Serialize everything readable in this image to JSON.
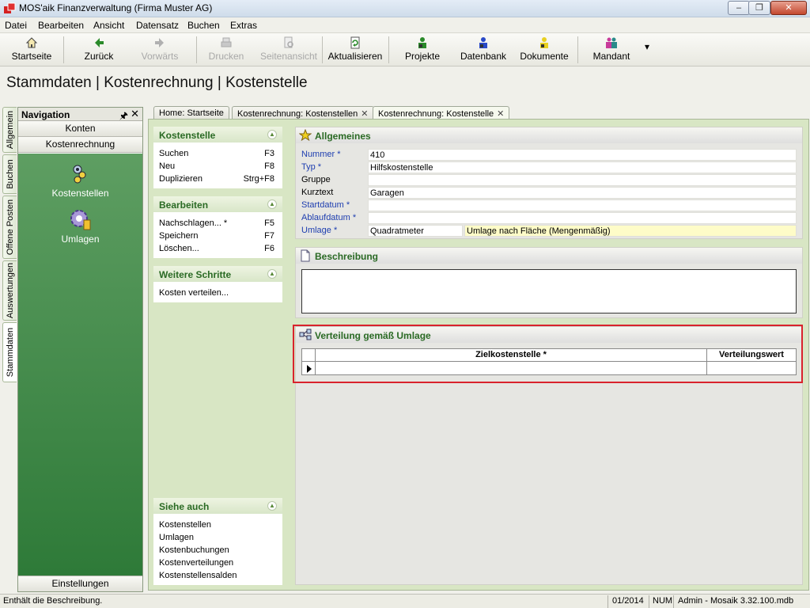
{
  "window": {
    "title": "MOS'aik Finanzverwaltung (Firma Muster AG)",
    "buttons": {
      "minimize": "–",
      "restore": "❐",
      "close": "✕"
    }
  },
  "menu": {
    "items": [
      {
        "label": "Datei"
      },
      {
        "label": "Bearbeiten"
      },
      {
        "label": "Ansicht"
      },
      {
        "label": "Datensatz"
      },
      {
        "label": "Buchen"
      },
      {
        "label": "Extras"
      }
    ]
  },
  "toolbar": {
    "startseite": "Startseite",
    "zurueck": "Zurück",
    "vorwaerts": "Vorwärts",
    "drucken": "Drucken",
    "seitenansicht": "Seitenansicht",
    "aktualisieren": "Aktualisieren",
    "projekte": "Projekte",
    "datenbank": "Datenbank",
    "dokumente": "Dokumente",
    "mandant": "Mandant",
    "more": "▾"
  },
  "page_title": "Stammdaten | Kostenrechnung | Kostenstelle",
  "vertical_tabs": [
    "Allgemein",
    "Buchen",
    "Offene Posten",
    "Auswertungen",
    "Stammdaten"
  ],
  "navigation": {
    "title": "Navigation",
    "pin": "🖈",
    "close": "✕",
    "groups": [
      "Konten",
      "Kostenrechnung"
    ],
    "entries": [
      "Kostenstellen",
      "Umlagen"
    ],
    "footer": "Einstellungen"
  },
  "doc_tabs": [
    {
      "label": "Home: Startseite",
      "closable": false
    },
    {
      "label": "Kostenrechnung: Kostenstellen",
      "closable": true
    },
    {
      "label": "Kostenrechnung: Kostenstelle",
      "closable": true
    }
  ],
  "tab_close": "✕",
  "tasks": {
    "kostenstelle": {
      "title": "Kostenstelle",
      "items": [
        {
          "label": "Suchen",
          "key": "F3"
        },
        {
          "label": "Neu",
          "key": "F8"
        },
        {
          "label": "Duplizieren",
          "key": "Strg+F8"
        }
      ]
    },
    "bearbeiten": {
      "title": "Bearbeiten",
      "items": [
        {
          "label": "Nachschlagen... *",
          "key": "F5"
        },
        {
          "label": "Speichern",
          "key": "F7"
        },
        {
          "label": "Löschen...",
          "key": "F6"
        }
      ]
    },
    "weitere": {
      "title": "Weitere Schritte",
      "items": [
        {
          "label": "Kosten verteilen...",
          "key": ""
        }
      ]
    },
    "siehe": {
      "title": "Siehe auch",
      "items": [
        {
          "label": "Kostenstellen"
        },
        {
          "label": "Umlagen"
        },
        {
          "label": "Kostenbuchungen"
        },
        {
          "label": "Kostenverteilungen"
        },
        {
          "label": "Kostenstellensalden"
        }
      ]
    },
    "collapse_glyph": "▲"
  },
  "allgemeines": {
    "title": "Allgemeines",
    "fields": {
      "nummer": {
        "label": "Nummer *",
        "value": "410"
      },
      "typ": {
        "label": "Typ *",
        "value": "Hilfskostenstelle"
      },
      "gruppe": {
        "label": "Gruppe",
        "value": ""
      },
      "kurztext": {
        "label": "Kurztext",
        "value": "Garagen"
      },
      "startdatum": {
        "label": "Startdatum *",
        "value": ""
      },
      "ablaufdatum": {
        "label": "Ablaufdatum *",
        "value": ""
      },
      "umlage": {
        "label": "Umlage *",
        "value": "Quadratmeter",
        "description": "Umlage nach Fläche (Mengenmäßig)"
      }
    }
  },
  "beschreibung": {
    "title": "Beschreibung",
    "value": ""
  },
  "verteilung": {
    "title": "Verteilung gemäß Umlage",
    "columns": [
      "Zielkostenstelle *",
      "Verteilungswert"
    ]
  },
  "status": {
    "message": "Enthält die Beschreibung.",
    "period": "01/2014",
    "num": "NUM",
    "user": "Admin - Mosaik 3.32.100.mdb"
  },
  "colors": {
    "nav_green": "#2e7a38",
    "section_title": "#2a6a24",
    "required_label": "#1e3eb0",
    "highlight": "#d9232d"
  }
}
